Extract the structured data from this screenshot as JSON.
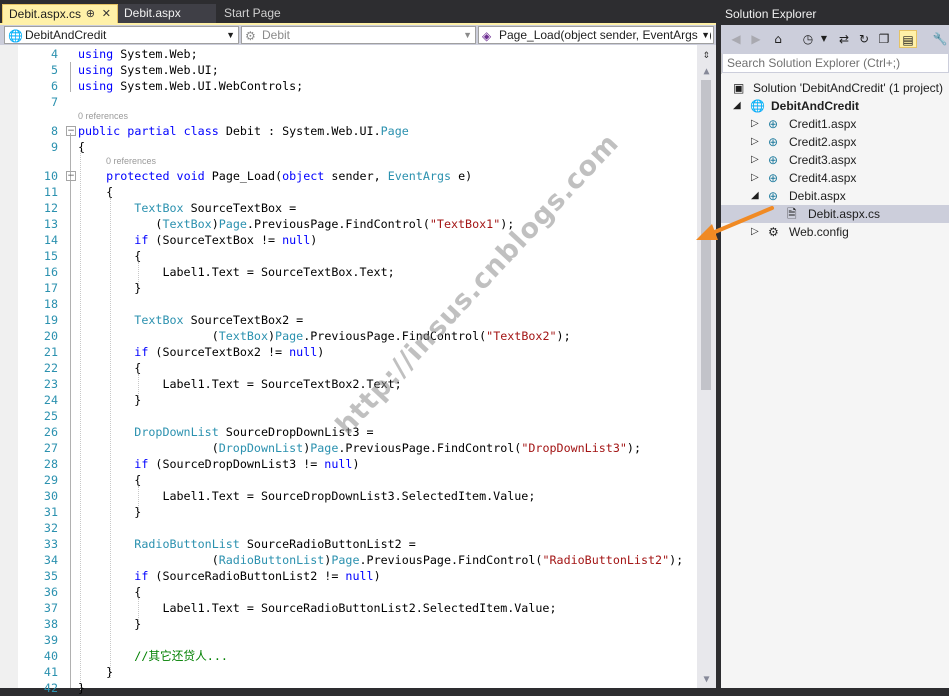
{
  "tabs": [
    {
      "label": "Debit.aspx.cs",
      "pin": "⊕",
      "close": "✕"
    },
    {
      "label": "Debit.aspx"
    },
    {
      "label": "Start Page"
    }
  ],
  "navigation": {
    "project": "DebitAndCredit",
    "class": "Debit",
    "member": "Page_Load(object sender, EventArgs e)"
  },
  "editor": {
    "references_label": "0 references",
    "lines": [
      {
        "n": "4",
        "code": "using System.Web;"
      },
      {
        "n": "5",
        "code": "using System.Web.UI;"
      },
      {
        "n": "6",
        "code": "using System.Web.UI.WebControls;"
      },
      {
        "n": "7",
        "code": ""
      },
      {
        "n": "8",
        "code": "public partial class Debit : System.Web.UI.Page"
      },
      {
        "n": "9",
        "code": "{"
      },
      {
        "n": "10",
        "code": "    protected void Page_Load(object sender, EventArgs e)"
      },
      {
        "n": "11",
        "code": "    {"
      },
      {
        "n": "12",
        "code": "        TextBox SourceTextBox ="
      },
      {
        "n": "13",
        "code": "           (TextBox)Page.PreviousPage.FindControl(\"TextBox1\");"
      },
      {
        "n": "14",
        "code": "        if (SourceTextBox != null)"
      },
      {
        "n": "15",
        "code": "        {"
      },
      {
        "n": "16",
        "code": "            Label1.Text = SourceTextBox.Text;"
      },
      {
        "n": "17",
        "code": "        }"
      },
      {
        "n": "18",
        "code": ""
      },
      {
        "n": "19",
        "code": "        TextBox SourceTextBox2 ="
      },
      {
        "n": "20",
        "code": "                   (TextBox)Page.PreviousPage.FindControl(\"TextBox2\");"
      },
      {
        "n": "21",
        "code": "        if (SourceTextBox2 != null)"
      },
      {
        "n": "22",
        "code": "        {"
      },
      {
        "n": "23",
        "code": "            Label1.Text = SourceTextBox2.Text;"
      },
      {
        "n": "24",
        "code": "        }"
      },
      {
        "n": "25",
        "code": ""
      },
      {
        "n": "26",
        "code": "        DropDownList SourceDropDownList3 ="
      },
      {
        "n": "27",
        "code": "                   (DropDownList)Page.PreviousPage.FindControl(\"DropDownList3\");"
      },
      {
        "n": "28",
        "code": "        if (SourceDropDownList3 != null)"
      },
      {
        "n": "29",
        "code": "        {"
      },
      {
        "n": "30",
        "code": "            Label1.Text = SourceDropDownList3.SelectedItem.Value;"
      },
      {
        "n": "31",
        "code": "        }"
      },
      {
        "n": "32",
        "code": ""
      },
      {
        "n": "33",
        "code": "        RadioButtonList SourceRadioButtonList2 ="
      },
      {
        "n": "34",
        "code": "                   (RadioButtonList)Page.PreviousPage.FindControl(\"RadioButtonList2\");"
      },
      {
        "n": "35",
        "code": "        if (SourceRadioButtonList2 != null)"
      },
      {
        "n": "36",
        "code": "        {"
      },
      {
        "n": "37",
        "code": "            Label1.Text = SourceRadioButtonList2.SelectedItem.Value;"
      },
      {
        "n": "38",
        "code": "        }"
      },
      {
        "n": "39",
        "code": ""
      },
      {
        "n": "40",
        "code": "        //其它还贷人..."
      },
      {
        "n": "41",
        "code": "    }"
      },
      {
        "n": "42",
        "code": "}"
      }
    ]
  },
  "watermark": "http://insus.cnblogs.com",
  "solution_explorer": {
    "title": "Solution Explorer",
    "search_placeholder": "Search Solution Explorer (Ctrl+;)",
    "tree": [
      {
        "label": "Solution 'DebitAndCredit' (1 project)",
        "icon": "solution-icon"
      },
      {
        "label": "DebitAndCredit",
        "icon": "web-project-icon"
      },
      {
        "label": "Credit1.aspx",
        "icon": "aspx-file-icon"
      },
      {
        "label": "Credit2.aspx",
        "icon": "aspx-file-icon"
      },
      {
        "label": "Credit3.aspx",
        "icon": "aspx-file-icon"
      },
      {
        "label": "Credit4.aspx",
        "icon": "aspx-file-icon"
      },
      {
        "label": "Debit.aspx",
        "icon": "aspx-file-icon"
      },
      {
        "label": "Debit.aspx.cs",
        "icon": "cs-file-icon"
      },
      {
        "label": "Web.config",
        "icon": "config-file-icon"
      }
    ]
  },
  "colors": {
    "keyword": "#0000ff",
    "type": "#2b91af",
    "string": "#a31515",
    "comment": "#008000",
    "arrow": "#f08a24",
    "active_tab": "#fff1a8"
  }
}
